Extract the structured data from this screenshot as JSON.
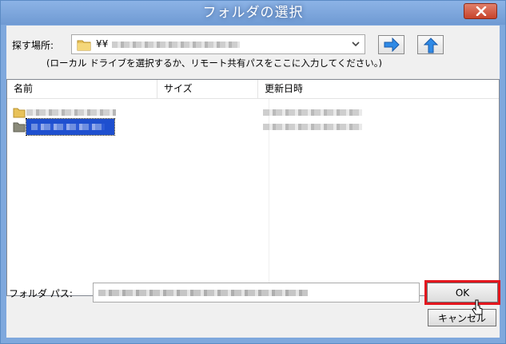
{
  "window": {
    "title": "フォルダの選択"
  },
  "location": {
    "label": "探す場所:",
    "value_prefix": "¥¥",
    "hint": "(ローカル ドライブを選択するか、リモート共有パスをここに入力してください。)"
  },
  "list": {
    "columns": [
      {
        "label": "名前"
      },
      {
        "label": "サイズ"
      },
      {
        "label": "更新日時"
      }
    ]
  },
  "folder_path": {
    "label": "フォルダ パス:"
  },
  "buttons": {
    "ok": "OK",
    "cancel": "キャンセル"
  },
  "colors": {
    "titlebar": "#7fa8dd",
    "selection": "#1e4fcf",
    "highlight_box": "#e3161e"
  },
  "icons": [
    "close-icon",
    "folder-icon",
    "dropdown-arrow-icon",
    "forward-arrow-icon",
    "up-arrow-icon",
    "mouse-cursor-icon"
  ]
}
